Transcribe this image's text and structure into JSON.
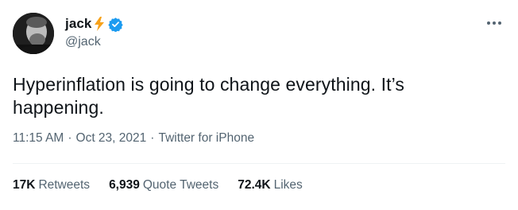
{
  "author": {
    "display_name": "jack",
    "handle": "@jack",
    "bolt_icon": "lightning-bolt-icon",
    "verified_icon": "verified-badge-icon",
    "verified_color": "#1d9bf0",
    "bolt_color": "#f7a21b"
  },
  "tweet": {
    "text": "Hyperinflation is going to change everything. It’s happening.",
    "time": "11:15 AM",
    "date": "Oct 23, 2021",
    "source": "Twitter for iPhone",
    "separator": "·"
  },
  "stats": {
    "retweets_count": "17K",
    "retweets_label": "Retweets",
    "quote_count": "6,939",
    "quote_label": "Quote Tweets",
    "likes_count": "72.4K",
    "likes_label": "Likes"
  },
  "menu": {
    "icon": "more-options-icon"
  },
  "colors": {
    "text_primary": "#0f1419",
    "text_secondary": "#536471",
    "divider": "#eff3f4"
  }
}
